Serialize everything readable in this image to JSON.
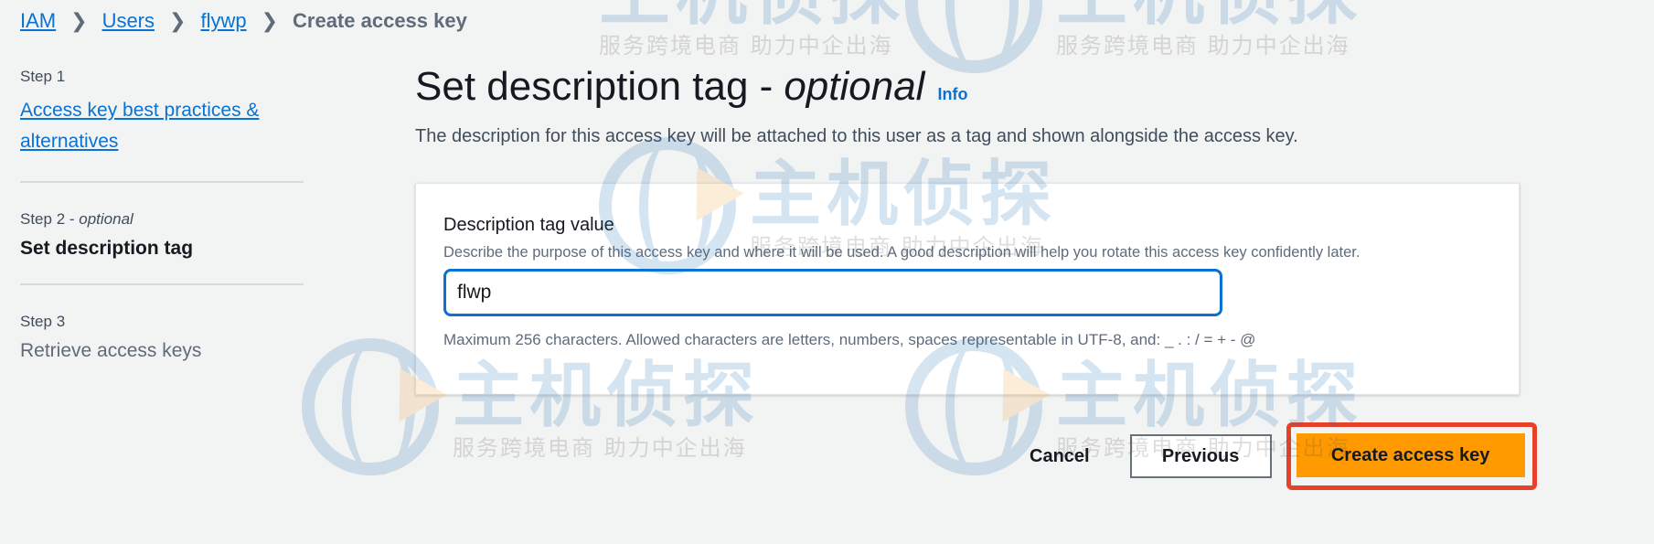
{
  "breadcrumb": {
    "items": [
      "IAM",
      "Users",
      "flywp"
    ],
    "current": "Create access key"
  },
  "steps": [
    {
      "num": "Step 1",
      "label": "Access key best practices & alternatives"
    },
    {
      "num": "Step 2",
      "num_suffix": "optional",
      "label": "Set description tag"
    },
    {
      "num": "Step 3",
      "label": "Retrieve access keys"
    }
  ],
  "main": {
    "title": "Set description tag -",
    "title_italic": "optional",
    "info": "Info",
    "subtitle": "The description for this access key will be attached to this user as a tag and shown alongside the access key."
  },
  "field": {
    "label": "Description tag value",
    "description": "Describe the purpose of this access key and where it will be used. A good description will help you rotate this access key confidently later.",
    "value": "flwp",
    "constraint": "Maximum 256 characters. Allowed characters are letters, numbers, spaces representable in UTF-8, and: _ . : / = + - @"
  },
  "actions": {
    "cancel": "Cancel",
    "previous": "Previous",
    "create": "Create access key"
  },
  "watermark": {
    "title": "主机侦探",
    "subtitle": "服务跨境电商  助力中企出海"
  },
  "colors": {
    "link": "#0972d3",
    "primary_button": "#ff9900",
    "highlight": "#e8412a",
    "background": "#f2f3f3"
  }
}
